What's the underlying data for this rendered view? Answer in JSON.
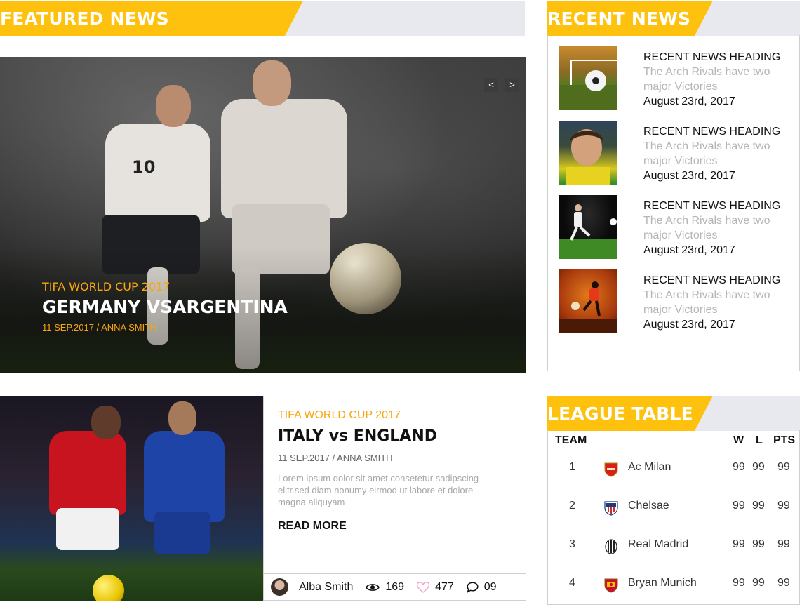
{
  "featured": {
    "section_title": "FEATURED NEWS",
    "slider": {
      "prev_label": "<",
      "next_label": ">"
    },
    "kicker": "TIFA WORLD CUP 2017",
    "title": "GERMANY VSARGENTINA",
    "meta": "11 SEP.2017 / ANNA SMITH",
    "jersey_number": "10"
  },
  "article2": {
    "kicker": "TIFA WORLD CUP 2017",
    "title": "ITALY vs ENGLAND",
    "meta": "11 SEP.2017 / ANNA SMITH",
    "body": "Lorem ipsum dolor sit amet.consetetur sadipscing elitr.sed diam nonumy eirmod ut labore et dolore magna aliquyam",
    "read_more": "READ MORE",
    "author": "Alba Smith",
    "views": "169",
    "likes": "477",
    "comments": "09"
  },
  "recent": {
    "section_title": "RECENT NEWS",
    "items": [
      {
        "heading": "RECENT NEWS HEADING",
        "desc": "The Arch Rivals have two major Victories",
        "date": "August 23rd, 2017"
      },
      {
        "heading": "RECENT NEWS HEADING",
        "desc": "The Arch Rivals have two major Victories",
        "date": "August 23rd, 2017"
      },
      {
        "heading": "RECENT NEWS HEADING",
        "desc": "The Arch Rivals have two major Victories",
        "date": "August 23rd, 2017"
      },
      {
        "heading": "RECENT NEWS HEADING",
        "desc": "The Arch Rivals have two major Victories",
        "date": "August 23rd, 2017"
      }
    ]
  },
  "league": {
    "section_title": "LEAGUE TABLE",
    "columns": {
      "team": "TEAM",
      "w": "W",
      "l": "L",
      "pts": "PTS"
    },
    "rows": [
      {
        "rank": "1",
        "team": "Ac Milan",
        "w": "99",
        "l": "99",
        "pts": "99",
        "crest_icon": "arsenal-crest-icon"
      },
      {
        "rank": "2",
        "team": "Chelsae",
        "w": "99",
        "l": "99",
        "pts": "99",
        "crest_icon": "usa-crest-icon"
      },
      {
        "rank": "3",
        "team": "Real Madrid",
        "w": "99",
        "l": "99",
        "pts": "99",
        "crest_icon": "juventus-crest-icon"
      },
      {
        "rank": "4",
        "team": "Bryan Munich",
        "w": "99",
        "l": "99",
        "pts": "99",
        "crest_icon": "spain-crest-icon"
      }
    ]
  },
  "colors": {
    "accent": "#fec10e",
    "kicker": "#f7a60e",
    "header_bg": "#e8e9ef",
    "like_icon": "#f3a0c4"
  }
}
